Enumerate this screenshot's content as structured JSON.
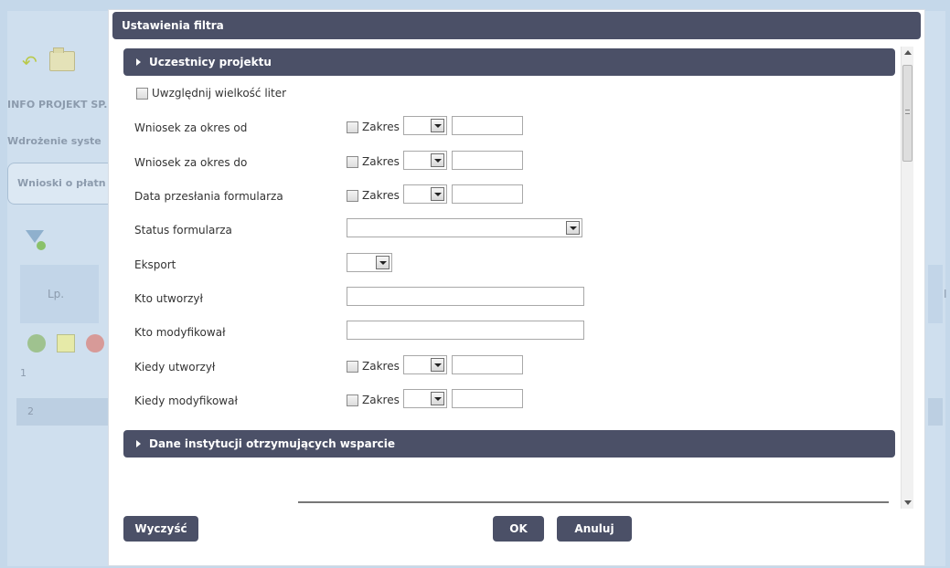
{
  "background": {
    "texts": [
      "INFO PROJEKT SP.",
      "Wdrożenie syste"
    ],
    "tab_label": "Wnioski o płatn",
    "column_lp": "Lp.",
    "rows": [
      "1",
      "2"
    ],
    "right_char": "I"
  },
  "dialog": {
    "title": "Ustawienia filtra",
    "section1": "Uczestnicy projektu",
    "section2": "Dane instytucji otrzymujących wsparcie",
    "case_checkbox_label": "Uwzględnij wielkość liter",
    "range_label": "Zakres",
    "fields": {
      "wniosek_od": "Wniosek za okres od",
      "wniosek_do": "Wniosek za okres do",
      "data_przeslania": "Data przesłania formularza",
      "status": "Status formularza",
      "eksport": "Eksport",
      "kto_utworzyl": "Kto utworzył",
      "kto_modyfikowal": "Kto modyfikował",
      "kiedy_utworzyl": "Kiedy utworzył",
      "kiedy_modyfikowal": "Kiedy modyfikował"
    },
    "buttons": {
      "clear": "Wyczyść",
      "ok": "OK",
      "cancel": "Anuluj"
    }
  },
  "colors": {
    "header_bg": "#4b5067",
    "app_bg": "#c5d8ea"
  }
}
